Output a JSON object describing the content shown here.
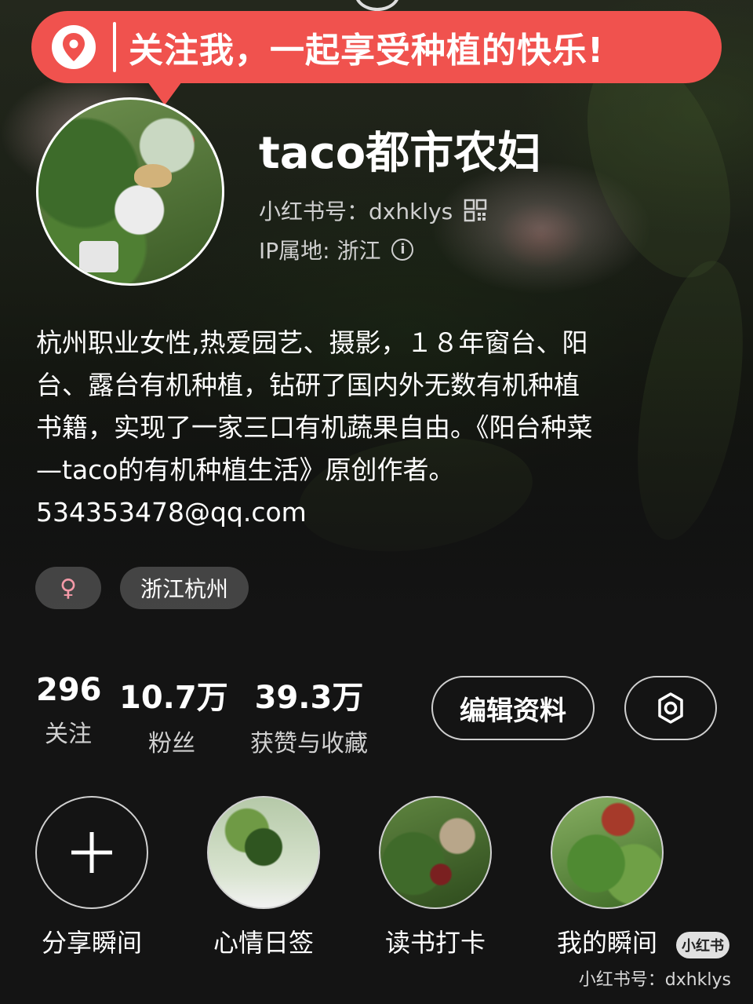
{
  "banner": {
    "text": "关注我，一起享受种植的快乐!",
    "color": "#f0524e"
  },
  "profile": {
    "name": "taco都市农妇",
    "id_label": "小红书号：dxhklys",
    "ip_label": "IP属地: 浙江",
    "avatar_icon": "avatar-photo"
  },
  "bio": {
    "lines": [
      "杭州职业女性,热爱园艺、摄影，１８年窗台、阳",
      "台、露台有机种植，钻研了国内外无数有机种植",
      "书籍，实现了一家三口有机蔬果自由。《阳台种菜",
      "—taco的有机种植生活》原创作者。",
      "534353478@qq.com"
    ]
  },
  "tags": {
    "gender_symbol": "♀",
    "gender_color": "#f49aa8",
    "location": "浙江杭州"
  },
  "stats": [
    {
      "value": "296",
      "label": "关注"
    },
    {
      "value": "10.7万",
      "label": "粉丝"
    },
    {
      "value": "39.3万",
      "label": "获赞与收藏"
    }
  ],
  "actions": {
    "edit_label": "编辑资料",
    "settings_icon": "gear-icon"
  },
  "highlights": [
    {
      "label": "分享瞬间",
      "icon": "plus-icon"
    },
    {
      "label": "心情日签",
      "icon": "thumbnail-photo"
    },
    {
      "label": "读书打卡",
      "icon": "thumbnail-photo"
    },
    {
      "label": "我的瞬间",
      "icon": "thumbnail-photo"
    }
  ],
  "watermark": {
    "logo": "小红书",
    "text": "小红书号：dxhklys"
  }
}
